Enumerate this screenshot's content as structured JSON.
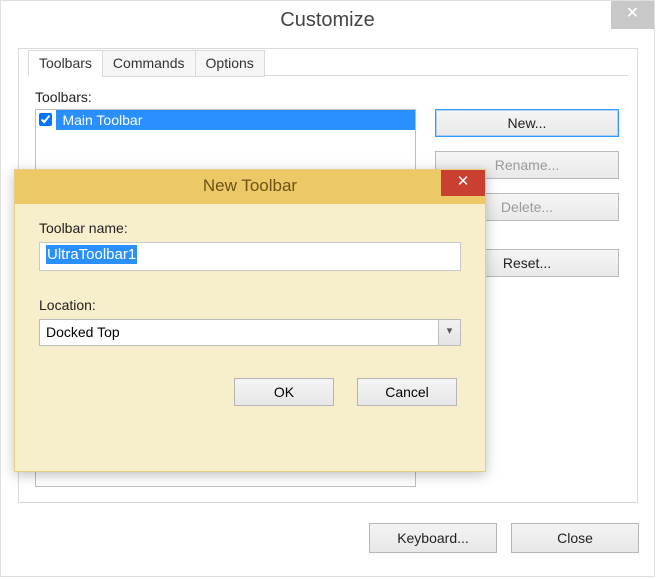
{
  "window": {
    "title": "Customize",
    "close_glyph": "✕"
  },
  "tabs": {
    "toolbars": "Toolbars",
    "commands": "Commands",
    "options": "Options"
  },
  "list": {
    "label": "Toolbars:",
    "items": [
      {
        "label": "Main Toolbar",
        "checked": true,
        "selected": true
      }
    ]
  },
  "side": {
    "new": "New...",
    "rename": "Rename...",
    "delete": "Delete...",
    "reset": "Reset..."
  },
  "bottom": {
    "keyboard": "Keyboard...",
    "close": "Close"
  },
  "modal": {
    "title": "New Toolbar",
    "close_glyph": "✕",
    "name_label": "Toolbar name:",
    "name_value": "UltraToolbar1",
    "location_label": "Location:",
    "location_value": "Docked Top",
    "ok": "OK",
    "cancel": "Cancel"
  }
}
